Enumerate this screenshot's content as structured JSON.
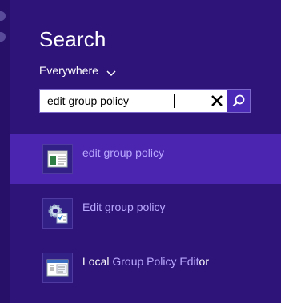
{
  "search_pane": {
    "title": "Search",
    "scope_label": "Everywhere",
    "query": "edit group policy"
  },
  "results": [
    {
      "label": "edit group policy",
      "icon": "settings-app-icon",
      "selected": true
    },
    {
      "label": "Edit group policy",
      "icon": "gear-checklist-icon",
      "selected": false
    },
    {
      "label_parts": [
        {
          "text": "Local ",
          "highlight": false
        },
        {
          "text": "Group Policy Edit",
          "highlight": true
        },
        {
          "text": "or",
          "highlight": false
        }
      ],
      "icon": "group-policy-editor-icon",
      "selected": false
    }
  ],
  "colors": {
    "background": "#2e1479",
    "selected_row": "#4b24b0",
    "highlight_text": "#b9a8ff",
    "search_button": "#4b2ab7"
  }
}
